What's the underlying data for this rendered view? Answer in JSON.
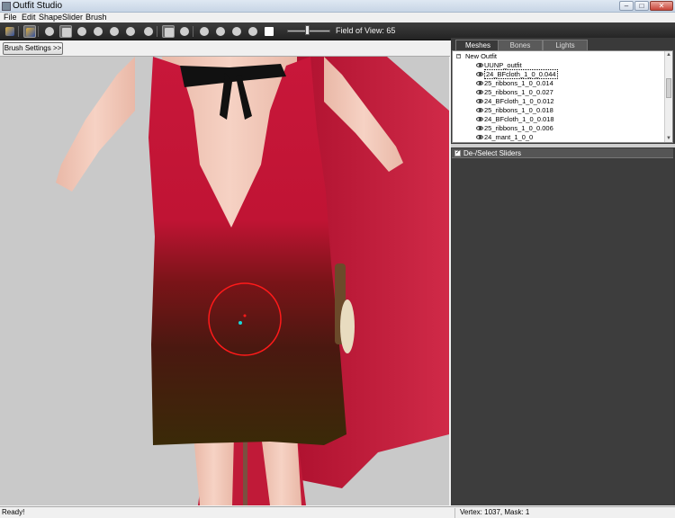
{
  "window": {
    "title": "Outfit Studio",
    "min": "–",
    "max": "□",
    "close": "✕"
  },
  "menu": [
    "File",
    "Edit",
    "Shape",
    "Slider",
    "Brush"
  ],
  "toolbar": {
    "tools": [
      {
        "name": "select-tool-icon",
        "selected": false,
        "kind": "brush"
      },
      {
        "name": "transform-tool-icon",
        "selected": true,
        "kind": "brush"
      },
      {
        "name": "mask-brush-icon",
        "selected": false,
        "kind": "round"
      },
      {
        "name": "inflate-brush-icon",
        "selected": true,
        "kind": "sq"
      },
      {
        "name": "deflate-brush-icon",
        "selected": false,
        "kind": "round"
      },
      {
        "name": "move-brush-icon",
        "selected": false,
        "kind": "round"
      },
      {
        "name": "smooth-brush-icon",
        "selected": false,
        "kind": "round"
      },
      {
        "name": "weight-brush-icon",
        "selected": false,
        "kind": "round"
      },
      {
        "name": "color-brush-icon",
        "selected": false,
        "kind": "round"
      },
      {
        "name": "mirror-x-icon",
        "selected": true,
        "kind": "sq"
      },
      {
        "name": "connected-icon",
        "selected": false,
        "kind": "round"
      },
      {
        "name": "vertex-view-icon",
        "selected": false,
        "kind": "round"
      },
      {
        "name": "wireframe-view-icon",
        "selected": false,
        "kind": "round"
      },
      {
        "name": "lighting-view-icon",
        "selected": false,
        "kind": "round"
      },
      {
        "name": "texture-view-icon",
        "selected": false,
        "kind": "round"
      },
      {
        "name": "cube-view-icon",
        "selected": false,
        "kind": "white"
      }
    ],
    "field_of_view_label": "Field of View: 65"
  },
  "brush_settings_label": "Brush Settings >>",
  "tabs": [
    {
      "label": "Meshes",
      "active": true
    },
    {
      "label": "Bones",
      "active": false
    },
    {
      "label": "Lights",
      "active": false
    }
  ],
  "mesh_tree": {
    "root": "New Outfit",
    "items": [
      {
        "label": "UUNP_outfit",
        "selected": false
      },
      {
        "label": "24_BFcloth_1_0_0.044",
        "selected": true
      },
      {
        "label": "25_ribbons_1_0_0.014",
        "selected": false
      },
      {
        "label": "25_ribbons_1_0_0.027",
        "selected": false
      },
      {
        "label": "24_BFcloth_1_0_0.012",
        "selected": false
      },
      {
        "label": "25_ribbons_1_0_0.018",
        "selected": false
      },
      {
        "label": "24_BFcloth_1_0_0.018",
        "selected": false
      },
      {
        "label": "25_ribbons_1_0_0.006",
        "selected": false
      },
      {
        "label": "24_mant_1_0_0",
        "selected": false
      }
    ]
  },
  "sliders": {
    "deselect_label": "De-/Select Sliders",
    "checked": true
  },
  "status": {
    "left": "Ready!",
    "right": "Vertex: 1037, Mask: 1"
  },
  "colors": {
    "dress_red": "#c21535",
    "dark_panel": "#3a3a3a",
    "skin": "#f2c7b7",
    "brush_circle": "#ff1a1a"
  }
}
